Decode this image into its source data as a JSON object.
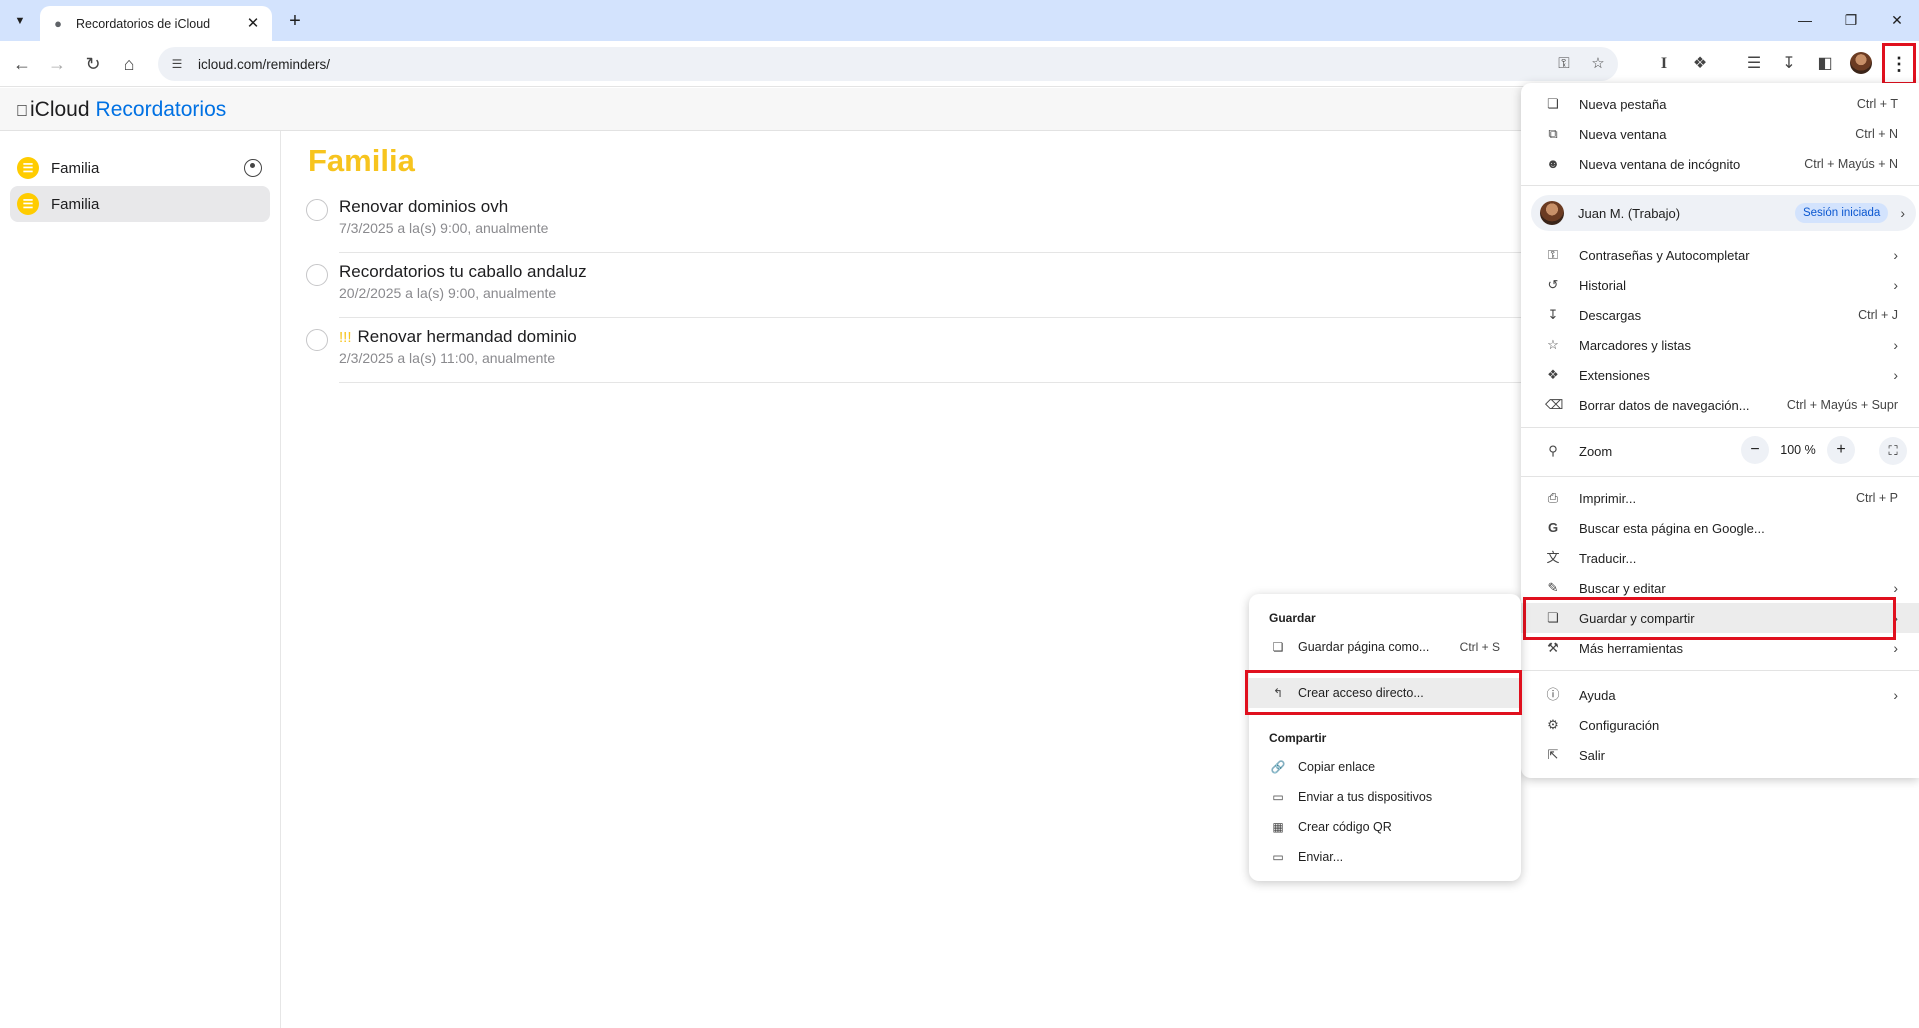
{
  "browser": {
    "tab_title": "Recordatorios de iCloud",
    "url": "icloud.com/reminders/"
  },
  "app": {
    "brand_icloud": "iCloud",
    "brand_app": "Recordatorios"
  },
  "sidebar": {
    "items": [
      {
        "label": "Familia",
        "shared": true,
        "selected": false
      },
      {
        "label": "Familia",
        "shared": false,
        "selected": true
      }
    ]
  },
  "main": {
    "list_title": "Familia",
    "title_color": "#f7c41e",
    "reminders": [
      {
        "priority": "",
        "title": "Renovar dominios ovh",
        "subtitle": "7/3/2025 a la(s) 9:00, anualmente"
      },
      {
        "priority": "",
        "title": "Recordatorios tu caballo andaluz",
        "subtitle": "20/2/2025 a la(s) 9:00, anualmente"
      },
      {
        "priority": "!!!",
        "title": "Renovar hermandad dominio",
        "subtitle": "2/3/2025 a la(s) 11:00, anualmente"
      }
    ]
  },
  "chrome_menu": {
    "items": [
      {
        "icon": "new-tab-icon",
        "label": "Nueva pestaña",
        "shortcut": "Ctrl + T"
      },
      {
        "icon": "new-window-icon",
        "label": "Nueva ventana",
        "shortcut": "Ctrl + N"
      },
      {
        "icon": "incognito-icon",
        "label": "Nueva ventana de incógnito",
        "shortcut": "Ctrl + Mayús + N"
      }
    ],
    "profile": {
      "name": "Juan M. (Trabajo)",
      "badge": "Sesión iniciada"
    },
    "items2": [
      {
        "icon": "key-icon",
        "label": "Contraseñas y Autocompletar",
        "shortcut": ""
      },
      {
        "icon": "history-icon",
        "label": "Historial",
        "shortcut": ""
      },
      {
        "icon": "download-icon",
        "label": "Descargas",
        "shortcut": "Ctrl + J"
      },
      {
        "icon": "star-icon",
        "label": "Marcadores y listas",
        "shortcut": ""
      },
      {
        "icon": "extensions-icon",
        "label": "Extensiones",
        "shortcut": ""
      },
      {
        "icon": "trash-icon",
        "label": "Borrar datos de navegación...",
        "shortcut": "Ctrl + Mayús + Supr"
      }
    ],
    "zoom": {
      "label": "Zoom",
      "value": "100 %"
    },
    "items3": [
      {
        "icon": "print-icon",
        "label": "Imprimir...",
        "shortcut": "Ctrl + P"
      },
      {
        "icon": "google-icon",
        "label": "Buscar esta página en Google...",
        "shortcut": ""
      },
      {
        "icon": "translate-icon",
        "label": "Traducir...",
        "shortcut": ""
      },
      {
        "icon": "find-edit-icon",
        "label": "Buscar y editar",
        "shortcut": ""
      },
      {
        "icon": "save-share-icon",
        "label": "Guardar y compartir",
        "shortcut": ""
      },
      {
        "icon": "tools-icon",
        "label": "Más herramientas",
        "shortcut": ""
      }
    ],
    "items4": [
      {
        "icon": "help-icon",
        "label": "Ayuda",
        "shortcut": ""
      },
      {
        "icon": "settings-icon",
        "label": "Configuración",
        "shortcut": ""
      },
      {
        "icon": "exit-icon",
        "label": "Salir",
        "shortcut": ""
      }
    ]
  },
  "submenu": {
    "save_heading": "Guardar",
    "save_page": {
      "label": "Guardar página como...",
      "shortcut": "Ctrl + S"
    },
    "create_shortcut": "Crear acceso directo...",
    "share_heading": "Compartir",
    "share_items": [
      {
        "icon": "link-icon",
        "label": "Copiar enlace"
      },
      {
        "icon": "send-devices-icon",
        "label": "Enviar a tus dispositivos"
      },
      {
        "icon": "qr-icon",
        "label": "Crear código QR"
      },
      {
        "icon": "cast-icon",
        "label": "Enviar..."
      }
    ]
  },
  "highlight_color": "#e0101e"
}
